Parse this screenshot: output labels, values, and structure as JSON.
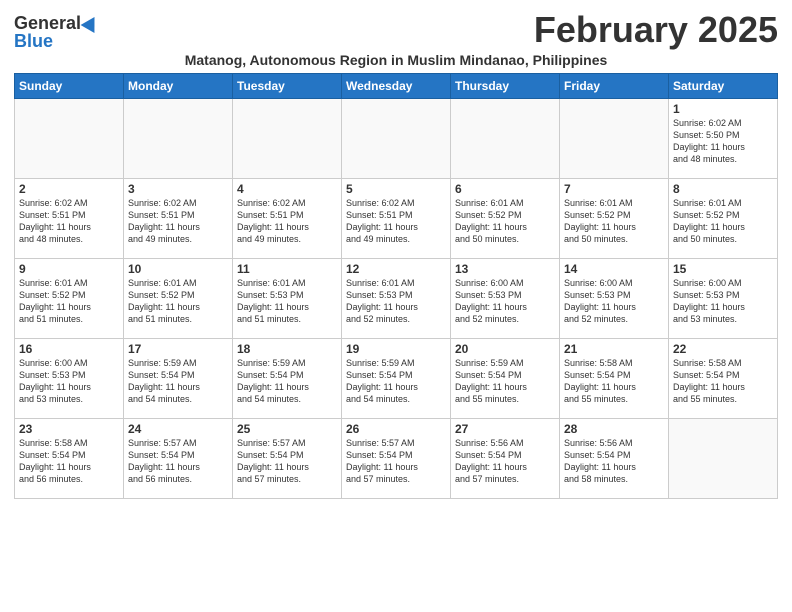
{
  "logo": {
    "general": "General",
    "blue": "Blue"
  },
  "title": "February 2025",
  "subtitle": "Matanog, Autonomous Region in Muslim Mindanao, Philippines",
  "weekdays": [
    "Sunday",
    "Monday",
    "Tuesday",
    "Wednesday",
    "Thursday",
    "Friday",
    "Saturday"
  ],
  "weeks": [
    [
      {
        "day": "",
        "info": ""
      },
      {
        "day": "",
        "info": ""
      },
      {
        "day": "",
        "info": ""
      },
      {
        "day": "",
        "info": ""
      },
      {
        "day": "",
        "info": ""
      },
      {
        "day": "",
        "info": ""
      },
      {
        "day": "1",
        "info": "Sunrise: 6:02 AM\nSunset: 5:50 PM\nDaylight: 11 hours\nand 48 minutes."
      }
    ],
    [
      {
        "day": "2",
        "info": "Sunrise: 6:02 AM\nSunset: 5:51 PM\nDaylight: 11 hours\nand 48 minutes."
      },
      {
        "day": "3",
        "info": "Sunrise: 6:02 AM\nSunset: 5:51 PM\nDaylight: 11 hours\nand 49 minutes."
      },
      {
        "day": "4",
        "info": "Sunrise: 6:02 AM\nSunset: 5:51 PM\nDaylight: 11 hours\nand 49 minutes."
      },
      {
        "day": "5",
        "info": "Sunrise: 6:02 AM\nSunset: 5:51 PM\nDaylight: 11 hours\nand 49 minutes."
      },
      {
        "day": "6",
        "info": "Sunrise: 6:01 AM\nSunset: 5:52 PM\nDaylight: 11 hours\nand 50 minutes."
      },
      {
        "day": "7",
        "info": "Sunrise: 6:01 AM\nSunset: 5:52 PM\nDaylight: 11 hours\nand 50 minutes."
      },
      {
        "day": "8",
        "info": "Sunrise: 6:01 AM\nSunset: 5:52 PM\nDaylight: 11 hours\nand 50 minutes."
      }
    ],
    [
      {
        "day": "9",
        "info": "Sunrise: 6:01 AM\nSunset: 5:52 PM\nDaylight: 11 hours\nand 51 minutes."
      },
      {
        "day": "10",
        "info": "Sunrise: 6:01 AM\nSunset: 5:52 PM\nDaylight: 11 hours\nand 51 minutes."
      },
      {
        "day": "11",
        "info": "Sunrise: 6:01 AM\nSunset: 5:53 PM\nDaylight: 11 hours\nand 51 minutes."
      },
      {
        "day": "12",
        "info": "Sunrise: 6:01 AM\nSunset: 5:53 PM\nDaylight: 11 hours\nand 52 minutes."
      },
      {
        "day": "13",
        "info": "Sunrise: 6:00 AM\nSunset: 5:53 PM\nDaylight: 11 hours\nand 52 minutes."
      },
      {
        "day": "14",
        "info": "Sunrise: 6:00 AM\nSunset: 5:53 PM\nDaylight: 11 hours\nand 52 minutes."
      },
      {
        "day": "15",
        "info": "Sunrise: 6:00 AM\nSunset: 5:53 PM\nDaylight: 11 hours\nand 53 minutes."
      }
    ],
    [
      {
        "day": "16",
        "info": "Sunrise: 6:00 AM\nSunset: 5:53 PM\nDaylight: 11 hours\nand 53 minutes."
      },
      {
        "day": "17",
        "info": "Sunrise: 5:59 AM\nSunset: 5:54 PM\nDaylight: 11 hours\nand 54 minutes."
      },
      {
        "day": "18",
        "info": "Sunrise: 5:59 AM\nSunset: 5:54 PM\nDaylight: 11 hours\nand 54 minutes."
      },
      {
        "day": "19",
        "info": "Sunrise: 5:59 AM\nSunset: 5:54 PM\nDaylight: 11 hours\nand 54 minutes."
      },
      {
        "day": "20",
        "info": "Sunrise: 5:59 AM\nSunset: 5:54 PM\nDaylight: 11 hours\nand 55 minutes."
      },
      {
        "day": "21",
        "info": "Sunrise: 5:58 AM\nSunset: 5:54 PM\nDaylight: 11 hours\nand 55 minutes."
      },
      {
        "day": "22",
        "info": "Sunrise: 5:58 AM\nSunset: 5:54 PM\nDaylight: 11 hours\nand 55 minutes."
      }
    ],
    [
      {
        "day": "23",
        "info": "Sunrise: 5:58 AM\nSunset: 5:54 PM\nDaylight: 11 hours\nand 56 minutes."
      },
      {
        "day": "24",
        "info": "Sunrise: 5:57 AM\nSunset: 5:54 PM\nDaylight: 11 hours\nand 56 minutes."
      },
      {
        "day": "25",
        "info": "Sunrise: 5:57 AM\nSunset: 5:54 PM\nDaylight: 11 hours\nand 57 minutes."
      },
      {
        "day": "26",
        "info": "Sunrise: 5:57 AM\nSunset: 5:54 PM\nDaylight: 11 hours\nand 57 minutes."
      },
      {
        "day": "27",
        "info": "Sunrise: 5:56 AM\nSunset: 5:54 PM\nDaylight: 11 hours\nand 57 minutes."
      },
      {
        "day": "28",
        "info": "Sunrise: 5:56 AM\nSunset: 5:54 PM\nDaylight: 11 hours\nand 58 minutes."
      },
      {
        "day": "",
        "info": ""
      }
    ]
  ]
}
